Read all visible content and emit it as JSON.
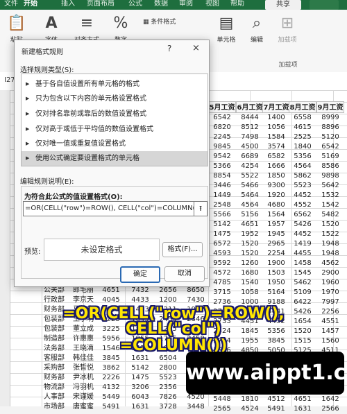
{
  "ribbon_tabs": [
    "文件",
    "开始",
    "插入",
    "页面布局",
    "公式",
    "数据",
    "审阅",
    "视图",
    "帮助"
  ],
  "share_label": "共享",
  "ribbon": {
    "paste": "粘贴",
    "font": "字体",
    "align": "对齐方式",
    "number": "数字",
    "cond_format": "条件格式",
    "cell": "单元格",
    "edit": "编辑",
    "addins": "加载项",
    "group_addins": "加载项"
  },
  "name_box": "I27",
  "dialog": {
    "title": "新建格式规则",
    "help": "?",
    "close": "×",
    "select_rule_type": "选择规则类型(S):",
    "rules": [
      "基于各自值设置所有单元格的格式",
      "只为包含以下内容的单元格设置格式",
      "仅对排名靠前或靠后的数值设置格式",
      "仅对高于或低于平均值的数值设置格式",
      "仅对唯一值或重复值设置格式",
      "使用公式确定要设置格式的单元格"
    ],
    "selected_rule": 5,
    "edit_rule_desc": "编辑规则说明(E):",
    "formula_label": "为符合此公式的值设置格式(O):",
    "formula_value": "=OR(CELL(\"row\")=ROW(), CELL(\"col\")=COLUMN())",
    "preview_label": "预览:",
    "preview_text": "未设定格式",
    "format_button": "格式(F)...",
    "ok_button": "确定",
    "cancel_button": "取消"
  },
  "grid": {
    "headers": [
      "5月工资",
      "6月工资",
      "7月工资",
      "8月工资",
      "9月工资"
    ],
    "rows": [
      [
        "6542",
        "8444",
        "1400",
        "6558",
        "8999"
      ],
      [
        "6820",
        "8512",
        "1056",
        "4615",
        "8896"
      ],
      [
        "2245",
        "7498",
        "1584",
        "2525",
        "5120"
      ],
      [
        "9845",
        "4500",
        "3574",
        "1840",
        "6542"
      ],
      [
        "9542",
        "6689",
        "6582",
        "5356",
        "5169"
      ],
      [
        "5366",
        "4254",
        "1666",
        "4564",
        "8586"
      ],
      [
        "8854",
        "5522",
        "1850",
        "5862",
        "9898"
      ],
      [
        "3446",
        "5466",
        "9300",
        "5523",
        "5642"
      ],
      [
        "1449",
        "5464",
        "1920",
        "4452",
        "1532"
      ],
      [
        "2548",
        "4564",
        "4680",
        "4552",
        "1542"
      ],
      [
        "5566",
        "5156",
        "1564",
        "6562",
        "5482"
      ],
      [
        "5142",
        "4651",
        "1957",
        "5426",
        "1520"
      ],
      [
        "1475",
        "1952",
        "1945",
        "4452",
        "1522"
      ],
      [
        "6572",
        "1520",
        "2965",
        "1419",
        "1948"
      ],
      [
        "4593",
        "1520",
        "2254",
        "4455",
        "1948"
      ],
      [
        "9592",
        "1260",
        "1900",
        "1458",
        "4562"
      ],
      [
        "4572",
        "1680",
        "1503",
        "1545",
        "2900"
      ],
      [
        "4785",
        "1540",
        "1950",
        "5462",
        "1960"
      ],
      [
        "3715",
        "1058",
        "5164",
        "5109",
        "1970"
      ],
      [
        "2736",
        "1000",
        "9188",
        "6422",
        "7997"
      ],
      [
        "2742",
        "6558",
        "5641",
        "5426",
        "2256"
      ],
      [
        "2733",
        "4451",
        "4452",
        "1654",
        "4551"
      ],
      [
        "2424",
        "1845",
        "5356",
        "1520",
        "1457"
      ],
      [
        "3784",
        "1955",
        "3845",
        "1515",
        "1560"
      ],
      [
        "3656",
        "4850",
        "5050",
        "5125",
        "4511"
      ],
      [
        "4452",
        "1845",
        "4522",
        "1544",
        "3580"
      ],
      [
        "2546",
        "1854",
        "3645",
        "5564",
        "6532"
      ],
      [
        "2442",
        "1845",
        "4513",
        "4452",
        "5455"
      ],
      [
        "5632",
        "1850",
        "4525",
        "1524",
        "5642"
      ],
      [
        "5448",
        "1810",
        "4512",
        "4651",
        "1642"
      ],
      [
        "2565",
        "4524",
        "5491",
        "1631",
        "2566"
      ]
    ],
    "left_rows": [
      [
        "公关部",
        "郎毛丽",
        "4651",
        "7432",
        "2656",
        "8650"
      ],
      [
        "行政部",
        "李京天",
        "4045",
        "4433",
        "1200",
        "7430"
      ],
      [
        "财务部",
        "马艳春",
        "1833",
        "1453",
        "3211",
        "1962"
      ],
      [
        "包装部",
        "王小明",
        "3225",
        "1845",
        "2453",
        "2346"
      ],
      [
        "包装部",
        "董立成",
        "3225",
        "1845",
        "2245",
        "1930"
      ],
      [
        "制造部",
        "许惠惠",
        "5956",
        "1955",
        "1745",
        "2450"
      ],
      [
        "法务部",
        "王晓滴",
        "1546",
        "5432",
        "1648",
        "2400"
      ],
      [
        "客服部",
        "韩佳佳",
        "3845",
        "1631",
        "6504",
        "1520"
      ],
      [
        "采购部",
        "张皙悦",
        "3862",
        "5142",
        "2800",
        "2450"
      ],
      [
        "财务部",
        "尹冰机",
        "2226",
        "1475",
        "5523",
        "4255"
      ],
      [
        "物流部",
        "冯羽机",
        "4132",
        "3206",
        "2356",
        "4520"
      ],
      [
        "人事部",
        "宋谨媛",
        "5449",
        "6043",
        "7826",
        "4520"
      ],
      [
        "市场部",
        "唐蜜蜜",
        "5491",
        "1631",
        "3728",
        "3448"
      ]
    ]
  },
  "overlay_formula_line1": "=OR(CELL(\"row\")=ROW(), CELL(\"col\")",
  "overlay_formula_line2": "=COLUMN())",
  "watermark": "www.aippt1.cc"
}
